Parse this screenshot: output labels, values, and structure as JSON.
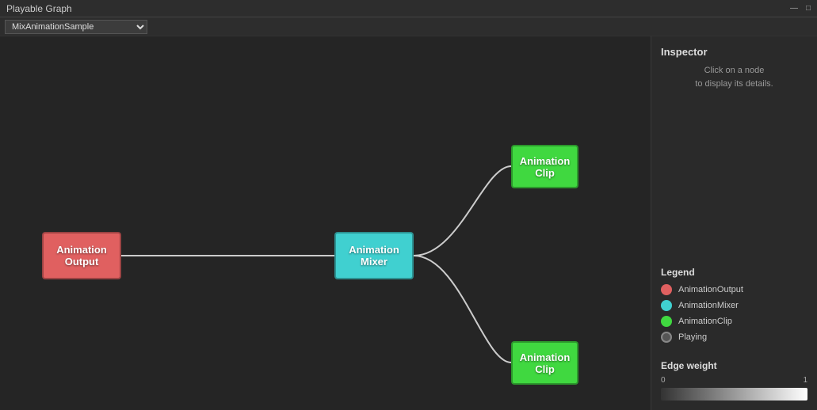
{
  "titleBar": {
    "title": "Playable Graph",
    "minimizeLabel": "—",
    "maximizeLabel": "□"
  },
  "dropdown": {
    "value": "MixAnimationSample",
    "options": [
      "MixAnimationSample"
    ]
  },
  "nodes": {
    "output": {
      "label": "Animation\nOutput",
      "line1": "Animation",
      "line2": "Output"
    },
    "mixer": {
      "label": "Animation\nMixer",
      "line1": "Animation",
      "line2": "Mixer"
    },
    "clip1": {
      "label": "Animation\nClip",
      "line1": "Animation",
      "line2": "Clip"
    },
    "clip2": {
      "label": "Animation\nClip",
      "line1": "Animation",
      "line2": "Clip"
    }
  },
  "inspector": {
    "title": "Inspector",
    "hint_line1": "Click on a node",
    "hint_line2": "to display its details."
  },
  "legend": {
    "title": "Legend",
    "items": [
      {
        "id": "output",
        "label": "AnimationOutput"
      },
      {
        "id": "mixer",
        "label": "AnimationMixer"
      },
      {
        "id": "clip",
        "label": "AnimationClip"
      },
      {
        "id": "playing",
        "label": "Playing"
      }
    ]
  },
  "edgeWeight": {
    "title": "Edge weight",
    "minLabel": "0",
    "maxLabel": "1"
  }
}
